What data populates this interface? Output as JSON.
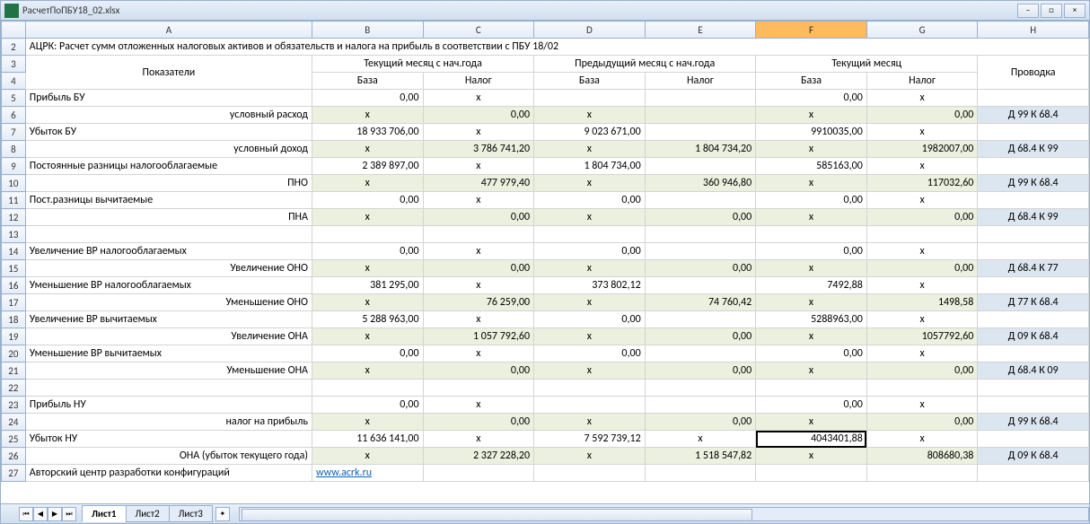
{
  "filename": "РасчетПоПБУ18_02.xlsx",
  "columns": [
    "A",
    "B",
    "C",
    "D",
    "E",
    "F",
    "G",
    "H"
  ],
  "selected_col": "F",
  "header_row4": [
    "Показатели",
    "База",
    "Налог",
    "База",
    "Налог",
    "База",
    "Налог",
    ""
  ],
  "group_headers": {
    "g1": "Текущий месяц с нач.года",
    "g2": "Предыдущий месяц с нач.года",
    "g3": "Текущий месяц",
    "g4": "Проводка"
  },
  "title_row": "АЦРК: Расчет сумм отложенных налоговых активов и обязательств и налога на прибыль в соответствии с ПБУ 18/02",
  "rows": [
    {
      "n": 5,
      "band": "even",
      "a": "Прибыль БУ",
      "ar": false,
      "b": "0,00",
      "c": "x",
      "d": "",
      "e": "",
      "f": "0,00",
      "g": "x",
      "h": ""
    },
    {
      "n": 6,
      "band": "a",
      "a": "условный расход",
      "ar": true,
      "b": "x",
      "c": "0,00",
      "d": "x",
      "e": "",
      "f": "x",
      "g": "0,00",
      "h": "Д 99 К 68.4"
    },
    {
      "n": 7,
      "band": "even",
      "a": "Убыток БУ",
      "ar": false,
      "b": "18 933 706,00",
      "c": "x",
      "d": "9 023 671,00",
      "e": "",
      "f": "9910035,00",
      "g": "x",
      "h": ""
    },
    {
      "n": 8,
      "band": "a",
      "a": "условный доход",
      "ar": true,
      "b": "x",
      "c": "3 786 741,20",
      "d": "x",
      "e": "1 804 734,20",
      "f": "x",
      "g": "1982007,00",
      "h": "Д 68.4 К 99"
    },
    {
      "n": 9,
      "band": "even",
      "a": "Постоянные разницы налогооблагаемые",
      "ar": false,
      "b": "2 389 897,00",
      "c": "x",
      "d": "1 804 734,00",
      "e": "",
      "f": "585163,00",
      "g": "x",
      "h": ""
    },
    {
      "n": 10,
      "band": "a",
      "a": "ПНО",
      "ar": true,
      "b": "x",
      "c": "477 979,40",
      "d": "x",
      "e": "360 946,80",
      "f": "x",
      "g": "117032,60",
      "h": "Д 99 К 68.4"
    },
    {
      "n": 11,
      "band": "even",
      "a": "Пост.разницы вычитаемые",
      "ar": false,
      "b": "0,00",
      "c": "x",
      "d": "0,00",
      "e": "",
      "f": "0,00",
      "g": "x",
      "h": ""
    },
    {
      "n": 12,
      "band": "a",
      "a": "ПНА",
      "ar": true,
      "b": "x",
      "c": "0,00",
      "d": "x",
      "e": "0,00",
      "f": "x",
      "g": "0,00",
      "h": "Д 68.4 К 99"
    },
    {
      "n": 13,
      "band": "even",
      "a": "",
      "ar": false,
      "b": "",
      "c": "",
      "d": "",
      "e": "",
      "f": "",
      "g": "",
      "h": ""
    },
    {
      "n": 14,
      "band": "even",
      "a": "Увеличение ВР налогооблагаемых",
      "ar": false,
      "b": "0,00",
      "c": "x",
      "d": "0,00",
      "e": "",
      "f": "0,00",
      "g": "x",
      "h": ""
    },
    {
      "n": 15,
      "band": "a",
      "a": "Увеличение ОНО",
      "ar": true,
      "b": "x",
      "c": "0,00",
      "d": "x",
      "e": "0,00",
      "f": "x",
      "g": "0,00",
      "h": "Д 68.4 К 77"
    },
    {
      "n": 16,
      "band": "even",
      "a": "Уменьшение ВР налогооблагаемых",
      "ar": false,
      "b": "381 295,00",
      "c": "x",
      "d": "373 802,12",
      "e": "",
      "f": "7492,88",
      "g": "x",
      "h": ""
    },
    {
      "n": 17,
      "band": "a",
      "a": "Уменьшение ОНО",
      "ar": true,
      "b": "x",
      "c": "76 259,00",
      "d": "x",
      "e": "74 760,42",
      "f": "x",
      "g": "1498,58",
      "h": "Д 77 К 68.4"
    },
    {
      "n": 18,
      "band": "even",
      "a": "Увеличение ВР вычитаемых",
      "ar": false,
      "b": "5 288 963,00",
      "c": "x",
      "d": "0,00",
      "e": "",
      "f": "5288963,00",
      "g": "x",
      "h": ""
    },
    {
      "n": 19,
      "band": "a",
      "a": "Увеличение ОНА",
      "ar": true,
      "b": "x",
      "c": "1 057 792,60",
      "d": "x",
      "e": "0,00",
      "f": "x",
      "g": "1057792,60",
      "h": "Д 09 К 68.4"
    },
    {
      "n": 20,
      "band": "even",
      "a": "Уменьшение ВР вычитаемых",
      "ar": false,
      "b": "0,00",
      "c": "x",
      "d": "0,00",
      "e": "",
      "f": "0,00",
      "g": "x",
      "h": ""
    },
    {
      "n": 21,
      "band": "a",
      "a": "Уменьшение ОНА",
      "ar": true,
      "b": "x",
      "c": "0,00",
      "d": "x",
      "e": "0,00",
      "f": "x",
      "g": "0,00",
      "h": "Д 68.4 К 09"
    },
    {
      "n": 22,
      "band": "even",
      "a": "",
      "ar": false,
      "b": "",
      "c": "",
      "d": "",
      "e": "",
      "f": "",
      "g": "",
      "h": ""
    },
    {
      "n": 23,
      "band": "even",
      "a": "Прибыль НУ",
      "ar": false,
      "b": "0,00",
      "c": "x",
      "d": "",
      "e": "",
      "f": "0,00",
      "g": "x",
      "h": ""
    },
    {
      "n": 24,
      "band": "a",
      "a": "налог на прибыль",
      "ar": true,
      "b": "x",
      "c": "0,00",
      "d": "x",
      "e": "0,00",
      "f": "x",
      "g": "0,00",
      "h": "Д 99 К 68.4"
    },
    {
      "n": 25,
      "band": "even",
      "a": "Убыток НУ",
      "ar": false,
      "b": "11 636 141,00",
      "c": "x",
      "d": "7 592 739,12",
      "e": "x",
      "f": "4043401,88",
      "g": "x",
      "h": "",
      "sel": true
    },
    {
      "n": 26,
      "band": "a",
      "a": "ОНА (убыток текущего года)",
      "ar": true,
      "b": "x",
      "c": "2 327 228,20",
      "d": "x",
      "e": "1 518 547,82",
      "f": "x",
      "g": "808680,38",
      "h": "Д 09 К 68.4"
    }
  ],
  "row27": {
    "n": 27,
    "a": "Авторский центр разработки конфигураций",
    "link": "www.acrk.ru"
  },
  "tabs": [
    "Лист1",
    "Лист2",
    "Лист3"
  ],
  "active_tab": 0
}
